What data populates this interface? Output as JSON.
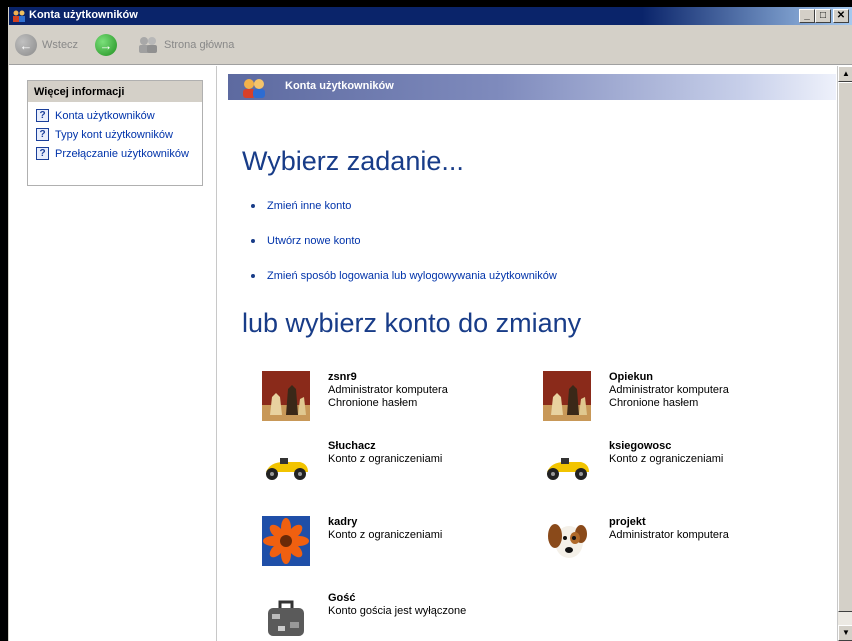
{
  "window": {
    "title": "Konta użytkowników"
  },
  "toolbar": {
    "back_label": "Wstecz",
    "forward_label": "",
    "home_label": "Strona główna"
  },
  "sidebar": {
    "title": "Więcej informacji",
    "items": [
      {
        "label": "Konta użytkowników"
      },
      {
        "label": "Typy kont użytkowników"
      },
      {
        "label": "Przełączanie użytkowników"
      }
    ]
  },
  "main": {
    "header": "Konta użytkowników",
    "task_heading": "Wybierz zadanie...",
    "tasks": [
      {
        "label": "Zmień inne konto"
      },
      {
        "label": "Utwórz nowe konto"
      },
      {
        "label": "Zmień sposób logowania lub wylogowywania użytkowników"
      }
    ],
    "account_heading": "lub wybierz konto do zmiany",
    "accounts": [
      {
        "name": "zsnr9",
        "line1": "Administrator komputera",
        "line2": "Chronione hasłem",
        "icon": "chess-icon"
      },
      {
        "name": "Opiekun",
        "line1": "Administrator komputera",
        "line2": "Chronione hasłem",
        "icon": "chess-icon"
      },
      {
        "name": "Słuchacz",
        "line1": "Konto z ograniczeniami",
        "line2": "",
        "icon": "racecar-icon"
      },
      {
        "name": "ksiegowosc",
        "line1": "Konto z ograniczeniami",
        "line2": "",
        "icon": "racecar-icon"
      },
      {
        "name": "kadry",
        "line1": "Konto z ograniczeniami",
        "line2": "",
        "icon": "flower-icon"
      },
      {
        "name": "projekt",
        "line1": "Administrator komputera",
        "line2": "",
        "icon": "dog-icon"
      },
      {
        "name": "Gość",
        "line1": "Konto gościa jest wyłączone",
        "line2": "",
        "icon": "suitcase-icon"
      }
    ]
  },
  "colors": {
    "heading": "#183c88",
    "link": "#0033aa",
    "titlebar": "#0a246a"
  }
}
